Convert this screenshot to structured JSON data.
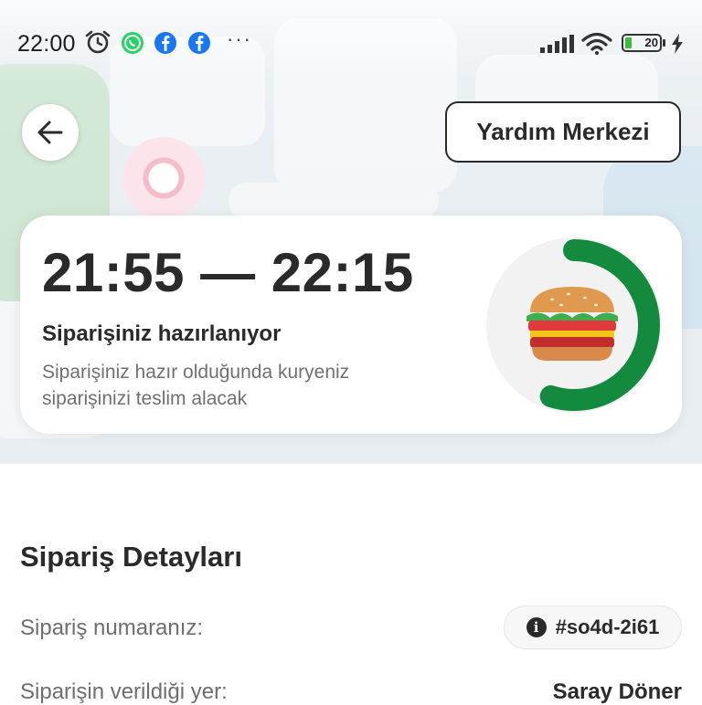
{
  "status_bar": {
    "time": "22:00",
    "battery": "20",
    "icons": [
      "alarm-icon",
      "whatsapp-icon",
      "facebook-icon",
      "facebook-icon",
      "more-dots-icon",
      "signal-icon",
      "wifi-icon",
      "battery-icon",
      "charging-icon"
    ],
    "more": "···"
  },
  "header": {
    "back_icon": "arrow-left-icon",
    "help_button": "Yardım Merkezi"
  },
  "order_status": {
    "eta": "21:55 — 22:15",
    "title": "Siparişiniz hazırlanıyor",
    "description": "Siparişiniz hazır olduğunda kuryeniz siparişinizi teslim alacak",
    "progress_icon": "burger-icon",
    "progress_fraction": 0.55,
    "progress_color": "#148a3e"
  },
  "details": {
    "title": "Sipariş Detayları",
    "order_number_label": "Sipariş numaranız:",
    "order_number": "#so4d-2i61",
    "placed_at_label": "Siparişin verildiği yer:",
    "placed_at": "Saray Döner"
  }
}
